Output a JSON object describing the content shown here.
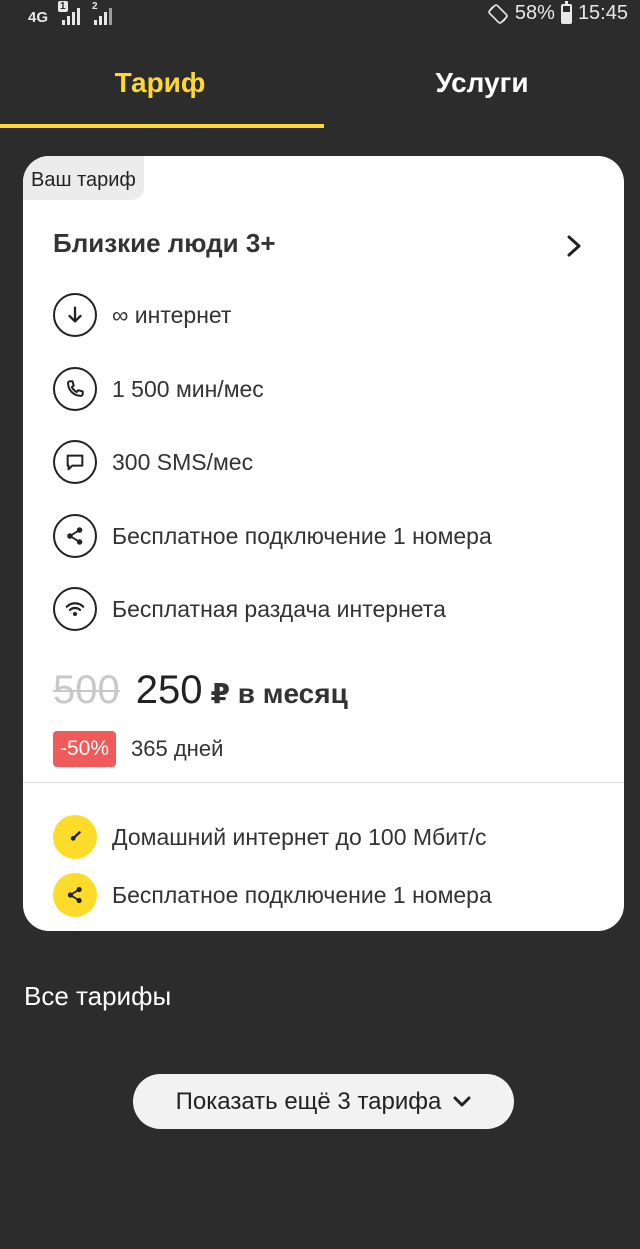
{
  "status_bar": {
    "network": "4G",
    "sim1": "1",
    "sim2": "2",
    "battery": "58%",
    "battery_level": 0.58,
    "time": "15:45"
  },
  "tabs": [
    {
      "label": "Тариф",
      "active": true
    },
    {
      "label": "Услуги",
      "active": false
    }
  ],
  "card": {
    "badge": "Ваш тариф",
    "title": "Близкие люди 3+",
    "features": [
      {
        "icon": "download-arrow-icon",
        "text": "∞ интернет"
      },
      {
        "icon": "phone-icon",
        "text": "1 500 мин/мес"
      },
      {
        "icon": "chat-bubble-icon",
        "text": "300 SMS/мес"
      },
      {
        "icon": "share-icon",
        "text": "Бесплатное подключение 1 номера"
      },
      {
        "icon": "wifi-icon",
        "text": "Бесплатная раздача интернета"
      }
    ],
    "old_price": "500",
    "new_price": "250",
    "price_unit": "₽ в месяц",
    "discount": "-50%",
    "duration": "365 дней",
    "bonuses": [
      {
        "icon": "speedometer-icon",
        "text": "Домашний интернет до 100 Мбит/с"
      },
      {
        "icon": "share-icon",
        "text": "Бесплатное подключение 1 номера"
      }
    ]
  },
  "all_tariffs": {
    "title": "Все тарифы",
    "show_more": "Показать ещё 3 тарифа"
  },
  "colors": {
    "background": "#2c2c2c",
    "accent": "#fdd835",
    "card": "#ffffff",
    "discount": "#f05a5a",
    "bonus_icon_bg": "#fddb2a"
  }
}
